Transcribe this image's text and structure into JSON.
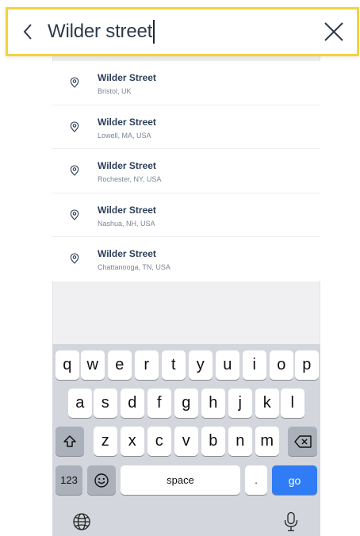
{
  "search": {
    "value": "Wilder street"
  },
  "results": [
    {
      "title": "Wilder Street",
      "subtitle": "Bristol, UK"
    },
    {
      "title": "Wilder Street",
      "subtitle": "Lowell, MA, USA"
    },
    {
      "title": "Wilder Street",
      "subtitle": "Rochester, NY, USA"
    },
    {
      "title": "Wilder Street",
      "subtitle": "Nashua, NH, USA"
    },
    {
      "title": "Wilder Street",
      "subtitle": "Chattanooga, TN, USA"
    }
  ],
  "keyboard": {
    "row1": [
      "q",
      "w",
      "e",
      "r",
      "t",
      "y",
      "u",
      "i",
      "o",
      "p"
    ],
    "row2": [
      "a",
      "s",
      "d",
      "f",
      "g",
      "h",
      "j",
      "k",
      "l"
    ],
    "row3": [
      "z",
      "x",
      "c",
      "v",
      "b",
      "n",
      "m"
    ],
    "numbers_label": "123",
    "space_label": "space",
    "period_label": ".",
    "go_label": "go"
  },
  "colors": {
    "highlight_border": "#f3d33c",
    "go_key": "#2f7cf6",
    "title_text": "#2c3e57"
  }
}
